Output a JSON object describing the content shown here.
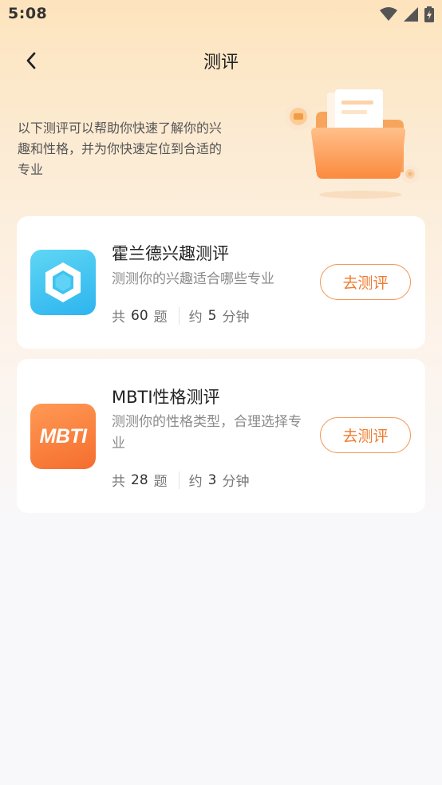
{
  "status_bar": {
    "time": "5:08"
  },
  "nav": {
    "title": "测评"
  },
  "intro": {
    "text": "以下测评可以帮助你快速了解你的兴趣和性格，并为你快速定位到合适的专业"
  },
  "assessments": [
    {
      "title": "霍兰德兴趣测评",
      "description": "测测你的兴趣适合哪些专业",
      "questions_prefix": "共",
      "questions": "60",
      "questions_suffix": "题",
      "time_prefix": "约",
      "minutes": "5",
      "time_suffix": "分钟",
      "button": "去测评",
      "icon": "hexagon-icon",
      "color": "#2db4ef"
    },
    {
      "title": "MBTI性格测评",
      "description": "测测你的性格类型，合理选择专业",
      "questions_prefix": "共",
      "questions": "28",
      "questions_suffix": "题",
      "time_prefix": "约",
      "minutes": "3",
      "time_suffix": "分钟",
      "button": "去测评",
      "icon": "mbti-logo-icon",
      "icon_text": "MBTI",
      "color": "#f56d2d"
    }
  ],
  "colors": {
    "accent": "#ef7a2e",
    "header_bg": "#fde4bd"
  }
}
